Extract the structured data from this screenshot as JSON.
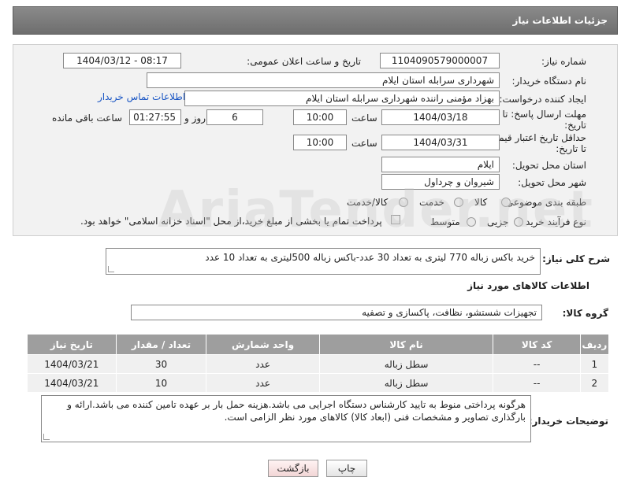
{
  "header": {
    "title": "جزئیات اطلاعات نیاز"
  },
  "form": {
    "need_number_label": "شماره نیاز:",
    "need_number": "1104090579000007",
    "announce_label": "تاریخ و ساعت اعلان عمومی:",
    "announce_value": "1404/03/12 - 08:17",
    "buyer_org_label": "نام دستگاه خریدار:",
    "buyer_org": "شهرداری سرابله استان ایلام",
    "requester_label": "ایجاد کننده درخواست:",
    "requester": "بهزاد مؤمنی راننده شهرداری سرابله استان ایلام",
    "contact_link": "اطلاعات تماس خریدار",
    "deadline_label_1": "مهلت ارسال پاسخ: تا",
    "deadline_label_2": "تاریخ:",
    "deadline_date": "1404/03/18",
    "time_label": "ساعت",
    "deadline_time": "10:00",
    "days_value": "6",
    "days_label": "روز و",
    "remaining_time": "01:27:55",
    "remaining_label": "ساعت باقی مانده",
    "price_label_1": "حداقل تاریخ اعتبار قیمت:",
    "price_label_2": "تا تاریخ:",
    "price_date": "1404/03/31",
    "price_time": "10:00",
    "province_label": "استان محل تحویل:",
    "province": "ایلام",
    "city_label": "شهر محل تحویل:",
    "city": "شیروان و چرداول",
    "category_label": "طبقه بندی موضوعی:",
    "category_options": [
      "کالا",
      "خدمت",
      "کالا/خدمت"
    ],
    "process_label": "نوع فرآیند خرید :",
    "process_options": [
      "جزیی",
      "متوسط"
    ],
    "payment_note": "پرداخت تمام یا بخشی از مبلغ خرید،از محل \"اسناد خزانه اسلامی\" خواهد بود."
  },
  "description": {
    "label": "شرح کلی نیاز:",
    "text": "خرید باکس زباله 770 لیتری به تعداد 30 عدد-باکس زباله 500لیتری به تعداد 10 عدد"
  },
  "goods": {
    "section_title": "اطلاعات کالاهای مورد نیاز",
    "group_label": "گروه کالا:",
    "group_value": "تجهیزات شستشو، نظافت، پاکسازی و تصفیه",
    "columns": [
      "ردیف",
      "کد کالا",
      "نام کالا",
      "واحد شمارش",
      "تعداد / مقدار",
      "تاریخ نیاز"
    ],
    "rows": [
      [
        "1",
        "--",
        "سطل زباله",
        "عدد",
        "30",
        "1404/03/21"
      ],
      [
        "2",
        "--",
        "سطل زباله",
        "عدد",
        "10",
        "1404/03/21"
      ]
    ]
  },
  "buyer_notes": {
    "label": "توضیحات خریدار:",
    "text": "هرگونه پرداختی منوط به تایید کارشناس دستگاه اجرایی می باشد.هزینه حمل بار بر عهده تامین کننده می باشد.ارائه و بارگذاری تصاویر و مشخصات فنی (ابعاد کالا) کالاهای مورد نظر الزامی است."
  },
  "buttons": {
    "print": "چاپ",
    "back": "بازگشت"
  },
  "colors": {
    "header": "#7a7a7a",
    "table_header": "#9e9e9e",
    "link": "#1a56c4"
  }
}
